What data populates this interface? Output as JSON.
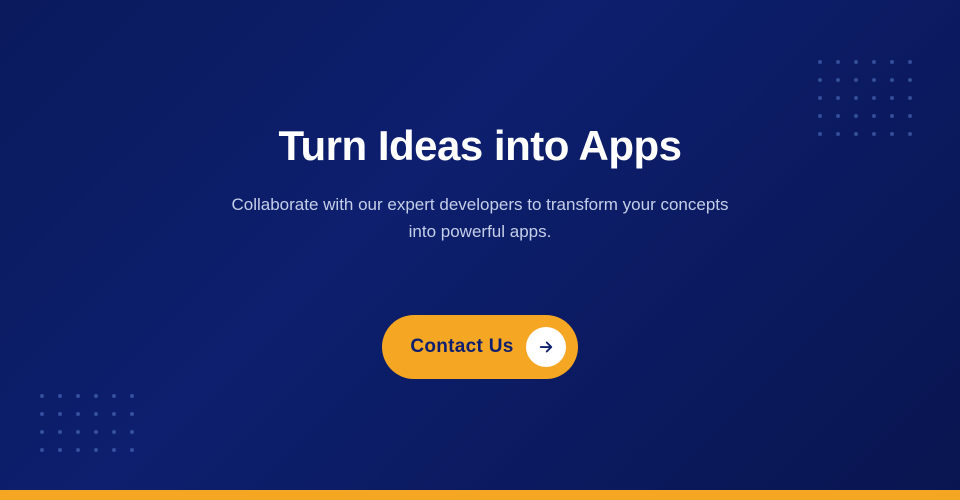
{
  "page": {
    "background_color": "#0a1a5c",
    "gold_bar_color": "#f5a623"
  },
  "hero": {
    "heading": "Turn Ideas into Apps",
    "subtext": "Collaborate with our expert developers to transform your concepts into powerful apps.",
    "cta_label": "Contact Us",
    "cta_arrow": "→"
  },
  "dots": {
    "color": "rgba(100, 140, 220, 0.45)"
  }
}
